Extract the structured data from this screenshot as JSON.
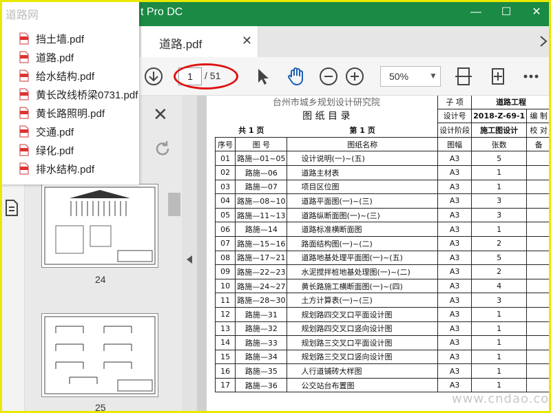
{
  "window": {
    "title": "t Pro DC",
    "minimize": "—",
    "maximize": "☐",
    "close": "✕"
  },
  "tab": {
    "label": "道路.pdf",
    "close": "✕"
  },
  "toolbar": {
    "page_current": "1",
    "page_total": "/ 51",
    "zoom": "50%",
    "zoom_arrow": "▼"
  },
  "recent_files": {
    "watermark": "道路网",
    "items": [
      "挡土墙.pdf",
      "道路.pdf",
      "给水结构.pdf",
      "黄长改线桥梁0731.pdf",
      "黄长路照明.pdf",
      "交通.pdf",
      "绿化.pdf",
      "排水结构.pdf"
    ]
  },
  "thumbnails": {
    "close": "✕",
    "pages": [
      "24",
      "25"
    ]
  },
  "document": {
    "institute": "台州市城乡规划设计研究院",
    "catalog_title": "图 纸 目 录",
    "project_label": "子  项",
    "project_value": "道路工程",
    "design_no_label": "设计号",
    "design_no_value": "2018-Z-69-1",
    "compile_label": "编  制",
    "total_pages": "共 1 页",
    "page_no": "第 1 页",
    "stage_label": "设计阶段",
    "stage_value": "施工图设计",
    "check_label": "校  对",
    "headers": [
      "序号",
      "图  号",
      "图纸名称",
      "图幅",
      "张数",
      "备"
    ],
    "rows": [
      [
        "01",
        "路施—01~05",
        "设计说明(一)~(五)",
        "A3",
        "5"
      ],
      [
        "02",
        "路施—06",
        "道路主材表",
        "A3",
        "1"
      ],
      [
        "03",
        "路施—07",
        "项目区位图",
        "A3",
        "1"
      ],
      [
        "04",
        "路施—08~10",
        "道路平面图(一)~(三)",
        "A3",
        "3"
      ],
      [
        "05",
        "路施—11~13",
        "道路纵断面图(一)~(三)",
        "A3",
        "3"
      ],
      [
        "06",
        "路施—14",
        "道路标准横断面图",
        "A3",
        "1"
      ],
      [
        "07",
        "路施—15~16",
        "路面结构图(一)~(二)",
        "A3",
        "2"
      ],
      [
        "08",
        "路施—17~21",
        "道路地基处理平面图(一)~(五)",
        "A3",
        "5"
      ],
      [
        "09",
        "路施—22~23",
        "水泥搅拌桩地基处理图(一)~(二)",
        "A3",
        "2"
      ],
      [
        "10",
        "路施—24~27",
        "黄长路施工横断面图(一)~(四)",
        "A3",
        "4"
      ],
      [
        "11",
        "路施—28~30",
        "土方计算表(一)~(三)",
        "A3",
        "3"
      ],
      [
        "12",
        "路施—31",
        "规划路四交叉口平面设计图",
        "A3",
        "1"
      ],
      [
        "13",
        "路施—32",
        "规划路四交叉口竖向设计图",
        "A3",
        "1"
      ],
      [
        "14",
        "路施—33",
        "规划路三交叉口平面设计图",
        "A3",
        "1"
      ],
      [
        "15",
        "路施—34",
        "规划路三交叉口竖向设计图",
        "A3",
        "1"
      ],
      [
        "16",
        "路施—35",
        "人行道铺砖大样图",
        "A3",
        "1"
      ],
      [
        "17",
        "路施—36",
        "公交站台布置图",
        "A3",
        "1"
      ]
    ]
  },
  "site_watermark": "www.cndao.com"
}
